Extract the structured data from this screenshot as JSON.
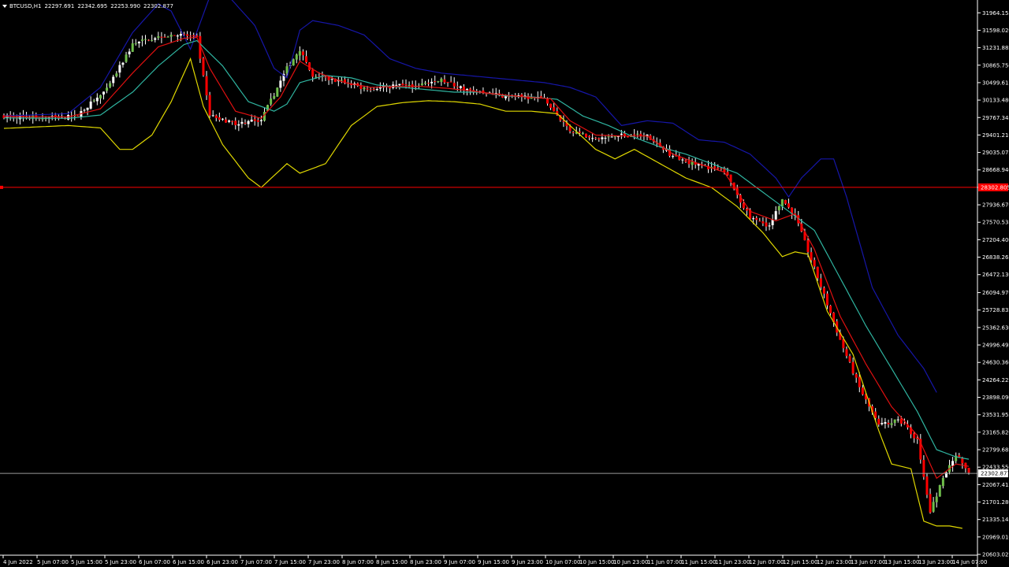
{
  "header": {
    "symbol": "BTCUSD,H1",
    "open": "22297.691",
    "high": "22342.695",
    "low": "22253.990",
    "close": "22302.877"
  },
  "colors": {
    "background": "#000000",
    "bull_body": "#ffffff",
    "bull_body_alt": "#6fbf4a",
    "bear_body": "#ff0000",
    "wick": "#ffffff",
    "upper_band": "#1616a8",
    "middle_band": "#2fb4a0",
    "lower_band": "#e0d800",
    "ma_fast": "#e01010",
    "level_line": "#ff0000",
    "bid_line": "#9a9a9a"
  },
  "chart_data": {
    "type": "candlestick",
    "symbol": "BTCUSD",
    "timeframe": "H1",
    "y_axis": {
      "range": [
        20603.027,
        32200
      ],
      "tick_labels": [
        "31964.155",
        "31598.020",
        "31231.885",
        "30865.750",
        "30499.615",
        "30133.480",
        "29767.345",
        "29401.210",
        "29035.075",
        "28668.940",
        "28302.805",
        "27936.670",
        "27570.535",
        "27204.400",
        "26838.265",
        "26472.130",
        "26094.970",
        "25728.835",
        "25362.630",
        "24996.495",
        "24630.360",
        "24264.225",
        "23898.090",
        "23531.955",
        "23165.820",
        "22799.685",
        "22433.550",
        "22067.415",
        "21701.280",
        "21335.145",
        "20969.010",
        "20603.027"
      ]
    },
    "x_axis": {
      "tick_labels": [
        "4 Jun 2022",
        "5 Jun 07:00",
        "5 Jun 15:00",
        "5 Jun 23:00",
        "6 Jun 07:00",
        "6 Jun 15:00",
        "6 Jun 23:00",
        "7 Jun 07:00",
        "7 Jun 15:00",
        "7 Jun 23:00",
        "8 Jun 07:00",
        "8 Jun 15:00",
        "8 Jun 23:00",
        "9 Jun 07:00",
        "9 Jun 15:00",
        "9 Jun 23:00",
        "10 Jun 07:00",
        "10 Jun 15:00",
        "10 Jun 23:00",
        "11 Jun 07:00",
        "11 Jun 15:00",
        "11 Jun 23:00",
        "12 Jun 07:00",
        "12 Jun 15:00",
        "12 Jun 23:00",
        "13 Jun 07:00",
        "13 Jun 15:00",
        "13 Jun 23:00",
        "14 Jun 07:00"
      ]
    },
    "level_line": {
      "price": 28302.805,
      "label": "28302.805"
    },
    "bid_line": {
      "price": 22302.877,
      "label": "22302.877"
    },
    "close_keypoints": [
      [
        0,
        29800
      ],
      [
        12,
        29760
      ],
      [
        22,
        29780
      ],
      [
        32,
        30350
      ],
      [
        40,
        31300
      ],
      [
        48,
        31480
      ],
      [
        56,
        31500
      ],
      [
        60,
        31420
      ],
      [
        64,
        29800
      ],
      [
        72,
        29650
      ],
      [
        80,
        29720
      ],
      [
        88,
        30800
      ],
      [
        92,
        31200
      ],
      [
        96,
        30600
      ],
      [
        104,
        30550
      ],
      [
        112,
        30380
      ],
      [
        120,
        30420
      ],
      [
        128,
        30450
      ],
      [
        136,
        30550
      ],
      [
        144,
        30350
      ],
      [
        152,
        30250
      ],
      [
        160,
        30200
      ],
      [
        168,
        30150
      ],
      [
        176,
        29500
      ],
      [
        184,
        29300
      ],
      [
        192,
        29400
      ],
      [
        200,
        29380
      ],
      [
        208,
        28950
      ],
      [
        216,
        28760
      ],
      [
        224,
        28650
      ],
      [
        232,
        27650
      ],
      [
        238,
        27500
      ],
      [
        242,
        28050
      ],
      [
        246,
        27700
      ],
      [
        252,
        26600
      ],
      [
        260,
        25100
      ],
      [
        266,
        24100
      ],
      [
        272,
        23300
      ],
      [
        278,
        23450
      ],
      [
        284,
        23000
      ],
      [
        288,
        21500
      ],
      [
        292,
        22200
      ],
      [
        296,
        22700
      ],
      [
        300,
        22302.877
      ]
    ],
    "upper_band_keypoints": [
      [
        0,
        29800
      ],
      [
        20,
        29850
      ],
      [
        30,
        30400
      ],
      [
        40,
        31550
      ],
      [
        48,
        32150
      ],
      [
        52,
        32000
      ],
      [
        58,
        31200
      ],
      [
        64,
        32300
      ],
      [
        70,
        32300
      ],
      [
        78,
        31700
      ],
      [
        84,
        30800
      ],
      [
        88,
        30600
      ],
      [
        92,
        31600
      ],
      [
        96,
        31800
      ],
      [
        104,
        31700
      ],
      [
        112,
        31500
      ],
      [
        120,
        31000
      ],
      [
        128,
        30800
      ],
      [
        136,
        30700
      ],
      [
        144,
        30650
      ],
      [
        152,
        30600
      ],
      [
        160,
        30550
      ],
      [
        168,
        30500
      ],
      [
        176,
        30400
      ],
      [
        184,
        30200
      ],
      [
        192,
        29600
      ],
      [
        200,
        29700
      ],
      [
        208,
        29650
      ],
      [
        216,
        29300
      ],
      [
        224,
        29250
      ],
      [
        232,
        29000
      ],
      [
        240,
        28500
      ],
      [
        244,
        28100
      ],
      [
        248,
        28500
      ],
      [
        254,
        28900
      ],
      [
        258,
        28900
      ],
      [
        262,
        28100
      ],
      [
        270,
        26200
      ],
      [
        278,
        25200
      ],
      [
        286,
        24500
      ],
      [
        290,
        24000
      ]
    ],
    "middle_band_keypoints": [
      [
        0,
        29760
      ],
      [
        20,
        29750
      ],
      [
        30,
        29820
      ],
      [
        40,
        30300
      ],
      [
        48,
        30850
      ],
      [
        56,
        31300
      ],
      [
        60,
        31380
      ],
      [
        68,
        30850
      ],
      [
        76,
        30100
      ],
      [
        84,
        29900
      ],
      [
        88,
        30050
      ],
      [
        92,
        30500
      ],
      [
        100,
        30650
      ],
      [
        108,
        30600
      ],
      [
        116,
        30450
      ],
      [
        124,
        30400
      ],
      [
        132,
        30350
      ],
      [
        140,
        30300
      ],
      [
        148,
        30300
      ],
      [
        156,
        30220
      ],
      [
        164,
        30200
      ],
      [
        172,
        30150
      ],
      [
        180,
        29800
      ],
      [
        188,
        29600
      ],
      [
        196,
        29350
      ],
      [
        204,
        29150
      ],
      [
        212,
        29000
      ],
      [
        220,
        28800
      ],
      [
        228,
        28600
      ],
      [
        236,
        28200
      ],
      [
        244,
        27800
      ],
      [
        252,
        27400
      ],
      [
        260,
        26400
      ],
      [
        268,
        25400
      ],
      [
        276,
        24500
      ],
      [
        284,
        23600
      ],
      [
        290,
        22800
      ],
      [
        296,
        22650
      ],
      [
        300,
        22600
      ]
    ],
    "lower_band_keypoints": [
      [
        0,
        29540
      ],
      [
        20,
        29600
      ],
      [
        30,
        29550
      ],
      [
        36,
        29100
      ],
      [
        40,
        29100
      ],
      [
        46,
        29400
      ],
      [
        52,
        30100
      ],
      [
        58,
        31000
      ],
      [
        62,
        30000
      ],
      [
        68,
        29200
      ],
      [
        76,
        28500
      ],
      [
        80,
        28300
      ],
      [
        88,
        28800
      ],
      [
        92,
        28600
      ],
      [
        100,
        28800
      ],
      [
        108,
        29600
      ],
      [
        116,
        30000
      ],
      [
        124,
        30080
      ],
      [
        132,
        30120
      ],
      [
        140,
        30100
      ],
      [
        148,
        30050
      ],
      [
        156,
        29900
      ],
      [
        164,
        29900
      ],
      [
        172,
        29850
      ],
      [
        176,
        29600
      ],
      [
        184,
        29100
      ],
      [
        190,
        28900
      ],
      [
        196,
        29100
      ],
      [
        204,
        28800
      ],
      [
        212,
        28500
      ],
      [
        220,
        28300
      ],
      [
        228,
        27900
      ],
      [
        236,
        27350
      ],
      [
        242,
        26850
      ],
      [
        246,
        26950
      ],
      [
        250,
        26900
      ],
      [
        256,
        25700
      ],
      [
        264,
        24800
      ],
      [
        272,
        23200
      ],
      [
        276,
        22500
      ],
      [
        282,
        22400
      ],
      [
        286,
        21300
      ],
      [
        290,
        21200
      ],
      [
        294,
        21200
      ],
      [
        298,
        21150
      ]
    ],
    "ma_fast_keypoints": [
      [
        0,
        29790
      ],
      [
        20,
        29780
      ],
      [
        30,
        29950
      ],
      [
        40,
        30700
      ],
      [
        48,
        31250
      ],
      [
        56,
        31430
      ],
      [
        60,
        31450
      ],
      [
        64,
        30800
      ],
      [
        72,
        29900
      ],
      [
        80,
        29750
      ],
      [
        86,
        30200
      ],
      [
        92,
        30950
      ],
      [
        98,
        30700
      ],
      [
        106,
        30500
      ],
      [
        114,
        30400
      ],
      [
        122,
        30420
      ],
      [
        130,
        30420
      ],
      [
        138,
        30380
      ],
      [
        146,
        30320
      ],
      [
        154,
        30250
      ],
      [
        162,
        30200
      ],
      [
        170,
        30160
      ],
      [
        176,
        29700
      ],
      [
        184,
        29400
      ],
      [
        192,
        29380
      ],
      [
        200,
        29380
      ],
      [
        208,
        29000
      ],
      [
        216,
        28800
      ],
      [
        224,
        28620
      ],
      [
        232,
        27800
      ],
      [
        240,
        27600
      ],
      [
        246,
        27750
      ],
      [
        252,
        27000
      ],
      [
        260,
        25600
      ],
      [
        268,
        24600
      ],
      [
        276,
        23700
      ],
      [
        284,
        23100
      ],
      [
        290,
        22200
      ],
      [
        296,
        22500
      ],
      [
        300,
        22450
      ]
    ]
  }
}
